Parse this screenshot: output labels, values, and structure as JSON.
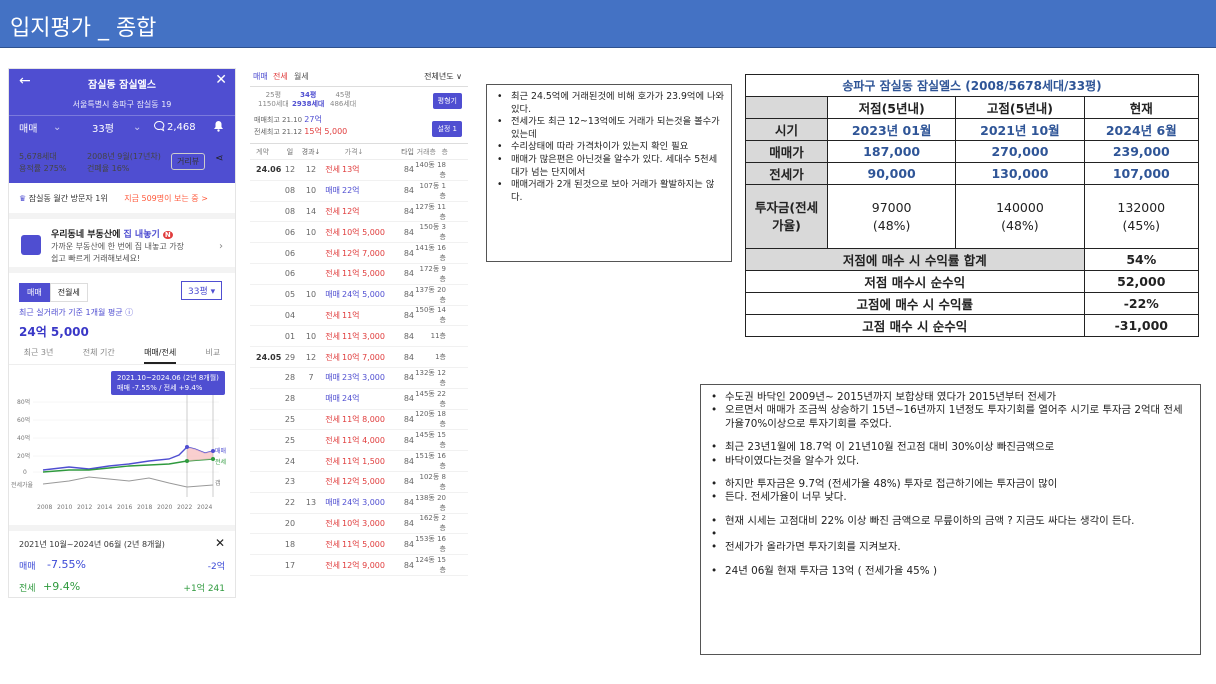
{
  "header": {
    "title": "입지평가 _ 종합"
  },
  "app": {
    "back_icon": "←",
    "close_icon": "✕",
    "apt_name": "잠실동 잠실엘스",
    "address": "서울특별시 송파구 잠실동 19",
    "trade_type": "매매",
    "size": "33평",
    "comments": "2,468",
    "info": {
      "households": "5,678세대",
      "far": "용적률 275%",
      "built": "2008년 9월(17년차)",
      "bcr": "건폐율 16%",
      "distance_btn": "거리뷰"
    },
    "rank_text": "잠실동 월간 방문자 1위",
    "rank_link": "지금 509명이 보는 중 >",
    "promo_title_a": "우리동네 부동산에 ",
    "promo_title_b": "집 내놓기",
    "promo_desc": "가까운 부동산에 한 번에 집 내놓고 가장 쉽고 빠르게 거래해보세요!",
    "tab_sale": "매매",
    "tab_rent": "전월세",
    "size_select": "33평",
    "avg_label": "최근 실거래가 기준 1개월 평균 ⓘ",
    "avg_value": "24억 5,000",
    "period_tabs": [
      "최근 3년",
      "전체 기간",
      "매매/전세",
      "비교"
    ],
    "tooltip_line1": "2021.10~2024.06 (2년 8개월)",
    "tooltip_line2": "매매 -7.55% / 전세 +9.4%",
    "chart_y_ticks": [
      "80억",
      "60억",
      "40억",
      "20억",
      "0"
    ],
    "chart_x_ticks": [
      "2008",
      "2010",
      "2012",
      "2014",
      "2016",
      "2018",
      "2020",
      "2022",
      "2024"
    ],
    "chart_legend_sale": "매매",
    "chart_legend_rent": "전세",
    "chart_legend_gap": "갭",
    "chart_rate_label": "전세가율",
    "summary_period": "2021년 10월~2024년 06월 (2년 8개월)",
    "sum_sale_label": "매매",
    "sum_sale_pct": "-7.55%",
    "sum_sale_amt": "-2억",
    "sum_rent_label": "전세",
    "sum_rent_pct": "+9.4%",
    "sum_rent_amt": "+1억 241"
  },
  "tx": {
    "tab_sale": "매매",
    "tab_rent": "전세",
    "tab_monthly": "월세",
    "year_select": "전체년도 ∨",
    "pyeong": [
      {
        "label": "25평",
        "sub": "1150세대"
      },
      {
        "label": "34평",
        "sub": "2938세대"
      },
      {
        "label": "45평",
        "sub": "486세대"
      }
    ],
    "compare_btn": "평형기",
    "recent_sale_label": "매매최고",
    "recent_sale_date": "21.10",
    "recent_sale_price": "27억",
    "recent_rent_label": "전세최고",
    "recent_rent_date": "21.12",
    "recent_rent_price": "15억 5,000",
    "setting_btn": "설정 1",
    "cols": [
      "계약",
      "일",
      "경과↓",
      "가격↓",
      "타입",
      "거래층",
      "층"
    ],
    "rows": [
      {
        "ym": "24.06",
        "d": "12",
        "f": "12",
        "k": "전세",
        "p": "13억",
        "t": "84",
        "fl": "140동 18층"
      },
      {
        "ym": "",
        "d": "08",
        "f": "10",
        "k": "매매",
        "p": "22억",
        "t": "84",
        "fl": "107동 1층"
      },
      {
        "ym": "",
        "d": "08",
        "f": "14",
        "k": "전세",
        "p": "12억",
        "t": "84",
        "fl": "127동 11층"
      },
      {
        "ym": "",
        "d": "06",
        "f": "10",
        "k": "전세",
        "p": "10억 5,000",
        "t": "84",
        "fl": "150동 3층"
      },
      {
        "ym": "",
        "d": "06",
        "f": "",
        "k": "전세",
        "p": "12억 7,000",
        "t": "84",
        "fl": "141동 16층"
      },
      {
        "ym": "",
        "d": "06",
        "f": "",
        "k": "전세",
        "p": "11억 5,000",
        "t": "84",
        "fl": "172동 9층"
      },
      {
        "ym": "",
        "d": "05",
        "f": "10",
        "k": "매매",
        "p": "24억 5,000",
        "t": "84",
        "fl": "137동 20층"
      },
      {
        "ym": "",
        "d": "04",
        "f": "",
        "k": "전세",
        "p": "11억",
        "t": "84",
        "fl": "150동 14층"
      },
      {
        "ym": "",
        "d": "01",
        "f": "10",
        "k": "전세",
        "p": "11억 3,000",
        "t": "84",
        "fl": "11층"
      },
      {
        "ym": "24.05",
        "d": "29",
        "f": "12",
        "k": "전세",
        "p": "10억 7,000",
        "t": "84",
        "fl": "1층"
      },
      {
        "ym": "",
        "d": "28",
        "f": "7",
        "k": "매매",
        "p": "23억 3,000",
        "t": "84",
        "fl": "132동 12층"
      },
      {
        "ym": "",
        "d": "28",
        "f": "",
        "k": "매매",
        "p": "24억",
        "t": "84",
        "fl": "145동 22층"
      },
      {
        "ym": "",
        "d": "25",
        "f": "",
        "k": "전세",
        "p": "11억 8,000",
        "t": "84",
        "fl": "120동 18층"
      },
      {
        "ym": "",
        "d": "25",
        "f": "",
        "k": "전세",
        "p": "11억 4,000",
        "t": "84",
        "fl": "145동 15층"
      },
      {
        "ym": "",
        "d": "24",
        "f": "",
        "k": "전세",
        "p": "11억 1,500",
        "t": "84",
        "fl": "151동 16층"
      },
      {
        "ym": "",
        "d": "23",
        "f": "",
        "k": "전세",
        "p": "12억 5,000",
        "t": "84",
        "fl": "102동 8층"
      },
      {
        "ym": "",
        "d": "22",
        "f": "13",
        "k": "매매",
        "p": "24억 3,000",
        "t": "84",
        "fl": "138동 20층"
      },
      {
        "ym": "",
        "d": "20",
        "f": "",
        "k": "전세",
        "p": "10억 3,000",
        "t": "84",
        "fl": "162동 2층"
      },
      {
        "ym": "",
        "d": "18",
        "f": "",
        "k": "전세",
        "p": "11억 5,000",
        "t": "84",
        "fl": "153동 16층"
      },
      {
        "ym": "",
        "d": "17",
        "f": "",
        "k": "전세",
        "p": "12억 9,000",
        "t": "84",
        "fl": "124동 15층"
      }
    ]
  },
  "note1": {
    "items": [
      "최근 24.5억에 거래된것에 비해 호가가 23.9억에 나와있다.",
      "전세가도 최근 12~13억에도 거래가 되는것을 볼수가 있는데",
      "수리상태에 따라 가격차이가 있는지 확인 필요",
      " 매매가 많은편은 아닌것을 알수가 있다. 세대수 5천세대가 넘는 단지에서",
      "매매거래가 2개 된것으로 보아 거래가 활발하지는 않다."
    ]
  },
  "table": {
    "caption": "송파구 잠실동 잠실엘스 (2008/5678세대/33평)",
    "cols": [
      "저점(5년내)",
      "고점(5년내)",
      "현재"
    ],
    "rows": [
      {
        "label": "시기",
        "v": [
          "2023년 01월",
          "2021년 10월",
          "2024년 6월"
        ]
      },
      {
        "label": "매매가",
        "v": [
          "187,000",
          "270,000",
          "239,000"
        ]
      },
      {
        "label": "전세가",
        "v": [
          "90,000",
          "130,000",
          "107,000"
        ]
      },
      {
        "label": "투자금(전세가율)",
        "v": [
          "97000",
          "140000",
          "132000"
        ],
        "v2": [
          "(48%)",
          "(48%)",
          "(45%)"
        ]
      }
    ],
    "summary": [
      {
        "label": "저점에 매수 시 수익률 합계",
        "value": "54%"
      },
      {
        "label": "저점 매수시 순수익",
        "value": "52,000"
      },
      {
        "label": "고점에 매수 시 수익률",
        "value": "-22%"
      },
      {
        "label": "고점 매수 시 순수익",
        "value": "-31,000"
      }
    ]
  },
  "note2": {
    "items": [
      "수도권 바닥인 2009년~ 2015년까지 보합상태 였다가 2015년부터  전세가",
      "오르면서 매매가 조금씩 상승하기  15년~16년까지 1년정도 투자기회를 열어주 시기로  투자금 2억대 전세가율70%이상으로  투자기회를 주었다.",
      "",
      "최근 23년1월에  18.7억 이 21년10월 전고점 대비 30%이상 빠진금액으로",
      "바닥이였다는것을  알수가 있다.",
      "",
      "하지만 투자금은 9.7억 (전세가율 48%)  투자로 접근하기에는 투자금이 많이",
      "든다. 전세가율이 너무 낮다.",
      "",
      "현재 시세는 고점대비  22% 이상  빠진 금액으로  무릎이하의  금액 ? 지금도 싸다는 생각이 든다.",
      "•",
      "전세가가 올라가면 투자기회를  지켜보자.",
      "",
      "24년 06월 현재 투자금 13억 ( 전세가율  45% )"
    ]
  },
  "colors": {
    "header": "#4472c4",
    "app": "#4f4ed1",
    "sale": "#4f4ed1",
    "rent": "#2f9a3e",
    "red": "#e03c3c"
  }
}
